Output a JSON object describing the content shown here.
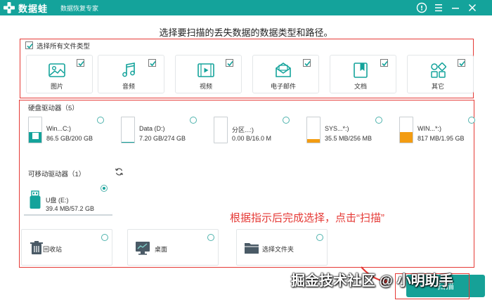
{
  "app": {
    "title": "数据蛙",
    "subtitle": "数据恢复专家"
  },
  "colors": {
    "accent": "#14a39b",
    "annotation": "#e53935"
  },
  "heading": "选择要扫描的丢失数据的数据类型和路径。",
  "file_types": {
    "select_all_label": "选择所有文件类型",
    "select_all_checked": true,
    "items": [
      {
        "label": "图片",
        "icon": "image-icon",
        "checked": true
      },
      {
        "label": "音频",
        "icon": "audio-icon",
        "checked": true
      },
      {
        "label": "视频",
        "icon": "video-icon",
        "checked": true
      },
      {
        "label": "电子邮件",
        "icon": "email-icon",
        "checked": true
      },
      {
        "label": "文档",
        "icon": "document-icon",
        "checked": true
      },
      {
        "label": "其它",
        "icon": "other-icon",
        "checked": true
      }
    ]
  },
  "hard_drives": {
    "label": "硬盘驱动器（5）",
    "items": [
      {
        "name": "Win...C:)",
        "size": "86.5 GB/200 GB",
        "used_fraction": 0.43,
        "color": "#14a39b"
      },
      {
        "name": "Data (D:)",
        "size": "7.20 GB/274 GB",
        "used_fraction": 0.03,
        "color": "#14a39b"
      },
      {
        "name": "分区...:)",
        "size": "0.00  B/16.0 M",
        "used_fraction": 0.0,
        "color": "#14a39b"
      },
      {
        "name": "SYS...*:)",
        "size": "35.5 MB/256 MB",
        "used_fraction": 0.14,
        "color": "#f39c12"
      },
      {
        "name": "WIN...*:)",
        "size": "817 MB/1.95 GB",
        "used_fraction": 0.42,
        "color": "#f39c12"
      }
    ]
  },
  "removable_drives": {
    "label": "可移动驱动器（1）",
    "items": [
      {
        "name": "U盘 (E:)",
        "size": "39.4 MB/57.2 GB",
        "selected": true
      }
    ]
  },
  "locations": [
    {
      "label": "回收站",
      "icon": "recycle-bin-icon"
    },
    {
      "label": "桌面",
      "icon": "desktop-icon"
    },
    {
      "label": "选择文件夹",
      "icon": "folder-icon"
    }
  ],
  "annotation": "根据指示后完成选择，点击“扫描”",
  "watermark": "掘金技术社区 @ 小明助手",
  "scan_button": "扫描"
}
